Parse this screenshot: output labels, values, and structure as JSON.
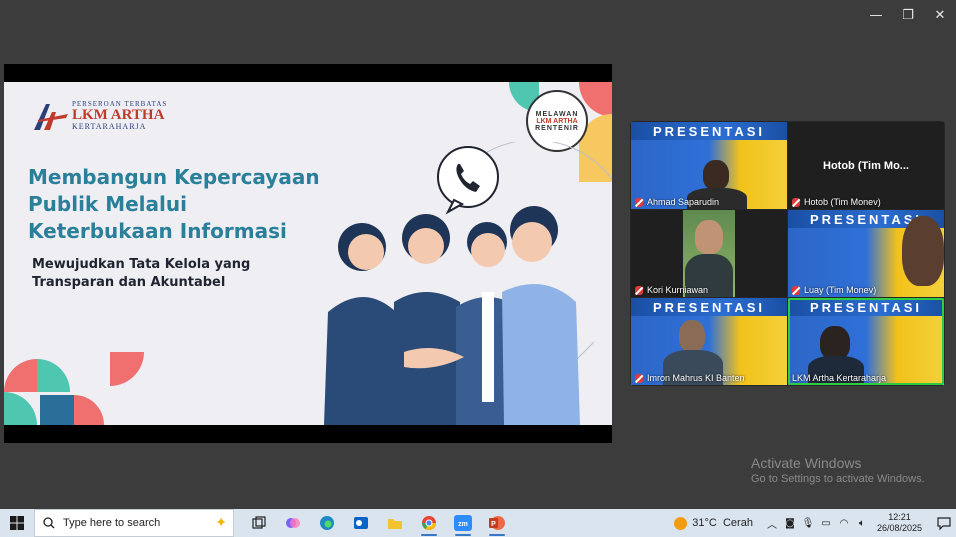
{
  "window": {
    "minimize": "—",
    "restore": "❐",
    "close": "✕"
  },
  "slide": {
    "logo": {
      "top": "PERSEROAN TERBATAS",
      "main": "LKM ARTHA",
      "sub": "KERTARAHARJA"
    },
    "badge": {
      "top": "MELAWAN",
      "middle": "LKM ARTHA",
      "bottom": "RENTENIR"
    },
    "headline": "Membangun Kepercayaan Publik Melalui Keterbukaan Informasi",
    "subline": "Mewujudkan Tata Kelola yang Transparan dan Akuntabel"
  },
  "gallery": {
    "tiles": [
      {
        "name": "Ahmad Saparudin",
        "type": "video",
        "banner": "PRESENTASI",
        "muted": true
      },
      {
        "name": "Hotob (Tim Monev)",
        "type": "black",
        "center_text": "Hotob (Tim Mo...",
        "muted": true
      },
      {
        "name": "Kori Kurniawan",
        "type": "video",
        "muted": true
      },
      {
        "name": "Luay (Tim Monev)",
        "type": "video",
        "banner": "PRESENTASI",
        "muted": true
      },
      {
        "name": "Imron Mahrus KI Banten",
        "type": "video",
        "banner": "PRESENTASI",
        "muted": true
      },
      {
        "name": "LKM Artha Kertaraharja",
        "type": "video",
        "banner": "PRESENTASI",
        "muted": false,
        "active": true
      }
    ]
  },
  "watermark": {
    "title": "Activate Windows",
    "subtitle": "Go to Settings to activate Windows."
  },
  "taskbar": {
    "search_placeholder": "Type here to search",
    "apps": [
      "task-view",
      "copilot",
      "edge",
      "outlook",
      "file-explorer",
      "chrome",
      "zoom",
      "powerpoint"
    ],
    "weather": {
      "temp": "31°C",
      "condition": "Cerah"
    },
    "clock": {
      "time": "12:21",
      "date": "26/08/2025"
    }
  },
  "colors": {
    "accent_teal": "#2a7f9a",
    "active_speaker": "#2ecc40",
    "taskbar_bg": "#d9e4ef"
  }
}
